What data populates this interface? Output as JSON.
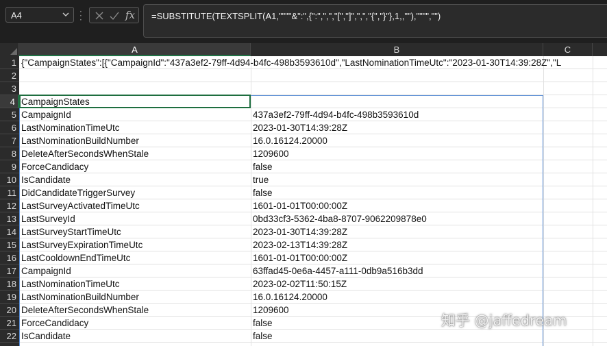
{
  "name_box": {
    "value": "A4"
  },
  "formula_bar": {
    "formula": "=SUBSTITUTE(TEXTSPLIT(A1,\"\"\"\"&\":\",{\":\",\",\",\"[\",\"]\",\",\",\"{\",\"}\"},1,,\"\"),\"\"\"\",\"\")"
  },
  "columns": [
    {
      "label": "A",
      "selected": true
    },
    {
      "label": "B",
      "selected": false
    },
    {
      "label": "C",
      "selected": false
    }
  ],
  "rows": [
    {
      "n": "1",
      "a": "{\"CampaignStates\":[{\"CampaignId\":\"437a3ef2-79ff-4d94-b4fc-498b3593610d\",\"LastNominationTimeUtc\":\"2023-01-30T14:39:28Z\",\"L",
      "b": ""
    },
    {
      "n": "2",
      "a": "",
      "b": ""
    },
    {
      "n": "3",
      "a": "",
      "b": ""
    },
    {
      "n": "4",
      "a": "CampaignStates",
      "b": ""
    },
    {
      "n": "5",
      "a": "CampaignId",
      "b": "437a3ef2-79ff-4d94-b4fc-498b3593610d"
    },
    {
      "n": "6",
      "a": "LastNominationTimeUtc",
      "b": "2023-01-30T14:39:28Z"
    },
    {
      "n": "7",
      "a": "LastNominationBuildNumber",
      "b": "16.0.16124.20000"
    },
    {
      "n": "8",
      "a": "DeleteAfterSecondsWhenStale",
      "b": "1209600"
    },
    {
      "n": "9",
      "a": "ForceCandidacy",
      "b": "false"
    },
    {
      "n": "10",
      "a": "IsCandidate",
      "b": "true"
    },
    {
      "n": "11",
      "a": "DidCandidateTriggerSurvey",
      "b": "false"
    },
    {
      "n": "12",
      "a": "LastSurveyActivatedTimeUtc",
      "b": "1601-01-01T00:00:00Z"
    },
    {
      "n": "13",
      "a": "LastSurveyId",
      "b": "0bd33cf3-5362-4ba8-8707-9062209878e0"
    },
    {
      "n": "14",
      "a": "LastSurveyStartTimeUtc",
      "b": "2023-01-30T14:39:28Z"
    },
    {
      "n": "15",
      "a": "LastSurveyExpirationTimeUtc",
      "b": "2023-02-13T14:39:28Z"
    },
    {
      "n": "16",
      "a": "LastCooldownEndTimeUtc",
      "b": "1601-01-01T00:00:00Z"
    },
    {
      "n": "17",
      "a": "CampaignId",
      "b": "63ffad45-0e6a-4457-a111-0db9a516b3dd"
    },
    {
      "n": "18",
      "a": "LastNominationTimeUtc",
      "b": "2023-02-02T11:50:15Z"
    },
    {
      "n": "19",
      "a": "LastNominationBuildNumber",
      "b": "16.0.16124.20000"
    },
    {
      "n": "20",
      "a": "DeleteAfterSecondsWhenStale",
      "b": "1209600"
    },
    {
      "n": "21",
      "a": "ForceCandidacy",
      "b": "false"
    },
    {
      "n": "22",
      "a": "IsCandidate",
      "b": "false"
    }
  ],
  "watermark": "知乎 @jaffedream",
  "colors": {
    "dark_bg": "#1f1f1f",
    "header_bg": "#2b2b2b",
    "selection": "#1e6e3f",
    "spill_border": "#5b8fd6"
  }
}
